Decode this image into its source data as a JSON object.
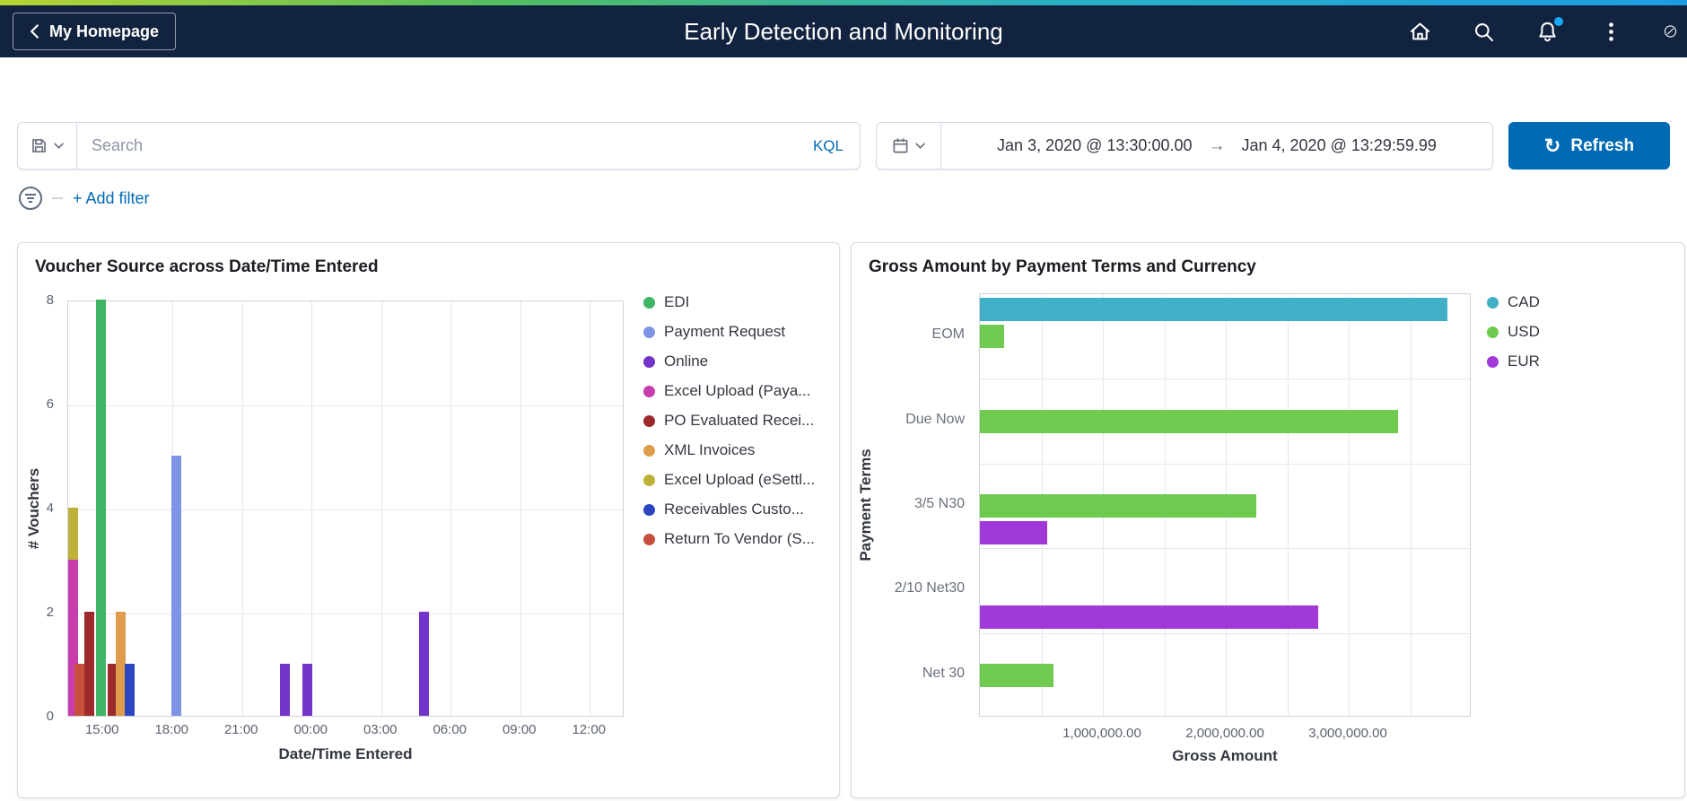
{
  "header": {
    "back_label": "My Homepage",
    "title": "Early Detection and Monitoring",
    "icons": [
      "home-icon",
      "search-icon",
      "notifications-icon",
      "kebab-menu-icon",
      "navbar-icon"
    ],
    "notification_dot_color": "#1ba9f5",
    "bar_color": "#12233f"
  },
  "query_bar": {
    "search_placeholder": "Search",
    "query_language": "KQL",
    "date_from": "Jan 3, 2020 @ 13:30:00.00",
    "date_separator": "→",
    "date_to": "Jan 4, 2020 @ 13:29:59.99",
    "refresh_label": "Refresh",
    "accent_color": "#006bb4"
  },
  "filter_bar": {
    "add_filter_label": "+ Add filter"
  },
  "chart_data": [
    {
      "type": "bar",
      "title": "Voucher Source across Date/Time Entered",
      "xlabel": "Date/Time Entered",
      "ylabel": "# Vouchers",
      "ylim": [
        0,
        8
      ],
      "yticks": [
        0,
        2,
        4,
        6,
        8
      ],
      "x_range": "Jan 3 13:30 to Jan 4 13:30",
      "xticks": [
        "15:00",
        "18:00",
        "21:00",
        "00:00",
        "03:00",
        "06:00",
        "09:00",
        "12:00"
      ],
      "grid": true,
      "legend_position": "right",
      "legend": [
        {
          "label": "EDI",
          "color": "#3eb564"
        },
        {
          "label": "Payment Request",
          "color": "#7d93e6"
        },
        {
          "label": "Online",
          "color": "#7534c8"
        },
        {
          "label": "Excel Upload (Paya...",
          "color": "#c93cad"
        },
        {
          "label": "PO Evaluated Recei...",
          "color": "#9c2a2a"
        },
        {
          "label": "XML Invoices",
          "color": "#df9c4c"
        },
        {
          "label": "Excel Upload (eSettl...",
          "color": "#bdb237"
        },
        {
          "label": "Receivables Custo...",
          "color": "#2b46c0"
        },
        {
          "label": "Return To Vendor (S...",
          "color": "#c7503c"
        }
      ],
      "bars": [
        {
          "day": 3,
          "time": "13:35",
          "segments": [
            {
              "series": "Excel Upload (Paya...",
              "value": 3
            },
            {
              "series": "Excel Upload (eSettl...",
              "value": 1
            }
          ]
        },
        {
          "day": 3,
          "time": "14:00",
          "segments": [
            {
              "series": "Return To Vendor (S...",
              "value": 1
            }
          ]
        },
        {
          "day": 3,
          "time": "14:25",
          "segments": [
            {
              "series": "PO Evaluated Recei...",
              "value": 2
            }
          ]
        },
        {
          "day": 3,
          "time": "14:55",
          "segments": [
            {
              "series": "EDI",
              "value": 8
            }
          ]
        },
        {
          "day": 3,
          "time": "15:25",
          "segments": [
            {
              "series": "PO Evaluated Recei...",
              "value": 1
            }
          ]
        },
        {
          "day": 3,
          "time": "15:45",
          "segments": [
            {
              "series": "XML Invoices",
              "value": 2
            }
          ]
        },
        {
          "day": 3,
          "time": "16:10",
          "segments": [
            {
              "series": "Receivables Custo...",
              "value": 1
            }
          ]
        },
        {
          "day": 3,
          "time": "18:10",
          "segments": [
            {
              "series": "Payment Request",
              "value": 5
            }
          ]
        },
        {
          "day": 3,
          "time": "22:50",
          "segments": [
            {
              "series": "Online",
              "value": 1
            }
          ]
        },
        {
          "day": 3,
          "time": "23:50",
          "segments": [
            {
              "series": "Online",
              "value": 1
            }
          ]
        },
        {
          "day": 4,
          "time": "04:50",
          "segments": [
            {
              "series": "Online",
              "value": 2
            }
          ]
        }
      ]
    },
    {
      "type": "bar",
      "orientation": "horizontal",
      "title": "Gross Amount by Payment Terms and Currency",
      "xlabel": "Gross Amount",
      "ylabel": "Payment Terms",
      "xlim": [
        0,
        4000000
      ],
      "xticks": [
        1000000,
        2000000,
        3000000
      ],
      "xtick_labels": [
        "1,000,000.00",
        "2,000,000.00",
        "3,000,000.00"
      ],
      "categories": [
        "EOM",
        "Due Now",
        "3/5 N30",
        "2/10 Net30",
        "Net 30"
      ],
      "grid": true,
      "legend_position": "right",
      "legend": [
        {
          "label": "CAD",
          "color": "#41b0c6"
        },
        {
          "label": "USD",
          "color": "#6fcb4f"
        },
        {
          "label": "EUR",
          "color": "#a138d8"
        }
      ],
      "groups": [
        {
          "category": "EOM",
          "bars": [
            {
              "series": "CAD",
              "value": 3800000
            },
            {
              "series": "USD",
              "value": 200000
            }
          ]
        },
        {
          "category": "Due Now",
          "bars": [
            {
              "series": "USD",
              "value": 3400000
            }
          ]
        },
        {
          "category": "3/5 N30",
          "bars": [
            {
              "series": "USD",
              "value": 2250000
            },
            {
              "series": "EUR",
              "value": 550000
            }
          ]
        },
        {
          "category": "2/10 Net30",
          "bars": [
            {
              "series": "EUR",
              "value": 2750000
            }
          ]
        },
        {
          "category": "Net 30",
          "bars": [
            {
              "series": "USD",
              "value": 600000
            }
          ]
        }
      ]
    }
  ]
}
